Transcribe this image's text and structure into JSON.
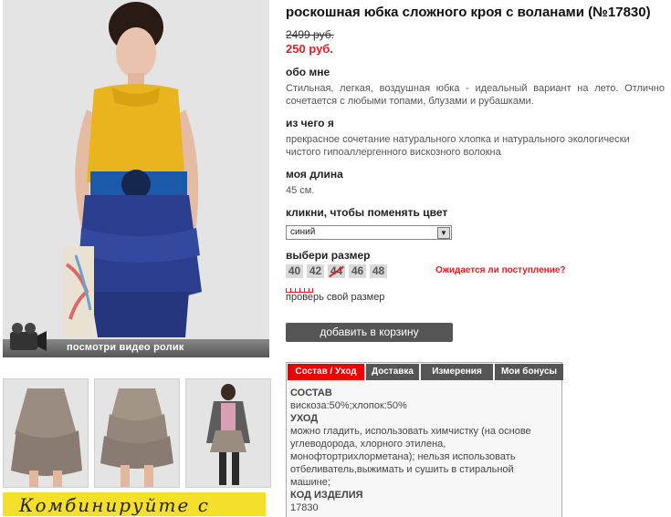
{
  "product": {
    "title": "роскошная юбка сложного кроя с воланами (№17830)",
    "old_price": "2499 руб.",
    "price": "250 руб."
  },
  "about": {
    "heading": "обо мне",
    "text": "Стильная, легкая, воздушная юбка - идеальный вариант на лето. Отлично сочетается с любыми топами, блузами и рубашками."
  },
  "material": {
    "heading": "из чего я",
    "text": "прекрасное сочетание натурального хлопка и натурального экологически чистого гипоаллергенного вискозного волокна"
  },
  "length": {
    "heading": "моя длина",
    "value": "45 см."
  },
  "color": {
    "heading": "кликни, чтобы поменять цвет",
    "selected": "синий"
  },
  "size": {
    "heading": "выбери размер",
    "options": [
      "40",
      "42",
      "44",
      "46",
      "48"
    ],
    "unavailable": [
      "44"
    ],
    "expect_link": "Ожидается ли поступление?",
    "check_link": "проверь свой размер"
  },
  "cart_button": "добавить в корзину",
  "video_label": "посмотри видео ролик",
  "promo_text": "Комбинируйте с блузами",
  "tabs": [
    "Состав / Уход",
    "Доставка",
    "Измерения",
    "Мои бонусы"
  ],
  "details": {
    "composition_h": "СОСТАВ",
    "composition": "вискоза:50%;хлопок:50%",
    "care_h": "УХОД",
    "care": "можно гладить, использовать химчистку (на основе углеводорода, хлорного этилена, монофтортрихлорметана); нельзя использовать отбеливатель,выжимать и сушить в стиральной машине;",
    "code_h": "КОД ИЗДЕЛИЯ",
    "code": "17830"
  },
  "colors": {
    "accent": "#e31e24",
    "button": "#555555",
    "skirt": "#2b3d8f",
    "top": "#e8b51f"
  }
}
